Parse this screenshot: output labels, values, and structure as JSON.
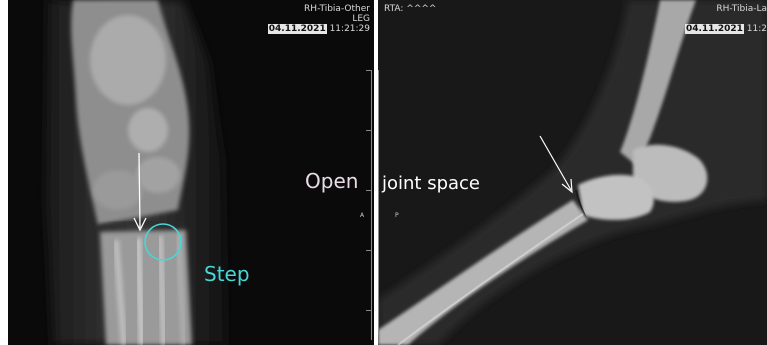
{
  "left_panel": {
    "series_label": "RH-Tibia-Other",
    "body_part": "LEG",
    "date": "04.11.2021",
    "time": "11:21:29",
    "annotation": "Step",
    "annotation_color": "#49d6d6",
    "orientation_mark": "A"
  },
  "right_panel": {
    "rta_label": "RTA: ^^^^",
    "series_label": "RH-Tibia-La",
    "date": "04.11.2021",
    "time": "11:2",
    "orientation_mark": "P"
  },
  "center_annotation": {
    "word_left": "Open",
    "word_right": "joint space",
    "left_color": "#e8dde6",
    "right_color": "#ffffff"
  }
}
